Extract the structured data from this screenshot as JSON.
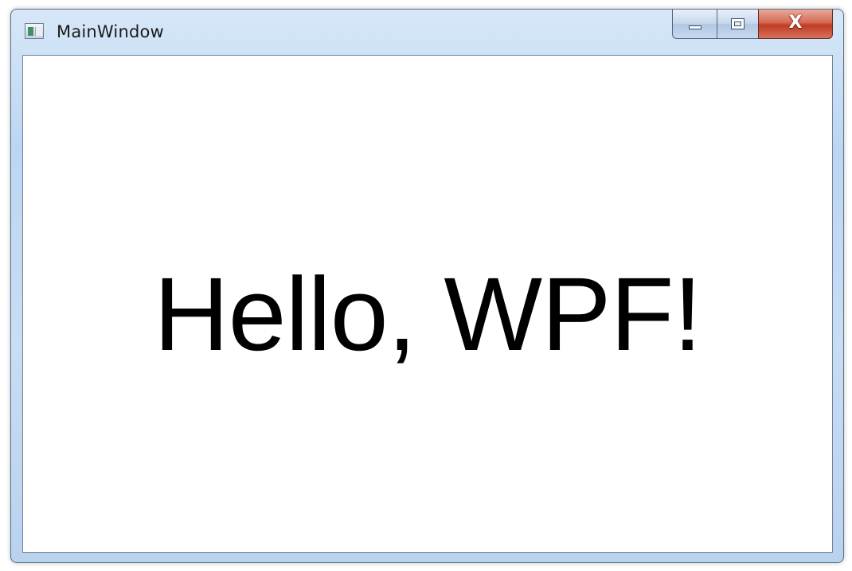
{
  "window": {
    "title": "MainWindow",
    "icon": "window-app-icon",
    "caption_buttons": {
      "minimize": "minimize-icon",
      "maximize": "maximize-icon",
      "close": "X"
    }
  },
  "content": {
    "greeting": "Hello, WPF!"
  },
  "colors": {
    "frame": "#bcd6f2",
    "close_button": "#c23b22",
    "client_background": "#ffffff",
    "text": "#000000"
  }
}
